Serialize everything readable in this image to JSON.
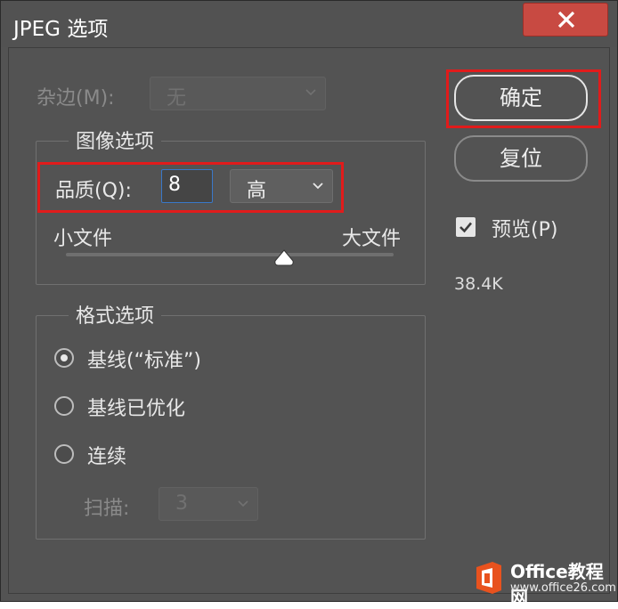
{
  "window": {
    "title": "JPEG 选项",
    "close_glyph": "✕"
  },
  "matte": {
    "label": "杂边(M):",
    "value": "无",
    "enabled": false
  },
  "image_options": {
    "title": "图像选项",
    "quality_label": "品质(Q):",
    "quality_value": "8",
    "quality_preset": "高",
    "slider_min_label": "小文件",
    "slider_max_label": "大文件",
    "slider_value": 8,
    "slider_max": 12
  },
  "format_options": {
    "title": "格式选项",
    "options": [
      {
        "label": "基线(“标准”)",
        "selected": true
      },
      {
        "label": "基线已优化",
        "selected": false
      },
      {
        "label": "连续",
        "selected": false
      }
    ],
    "scans_label": "扫描:",
    "scans_value": "3",
    "scans_enabled": false
  },
  "buttons": {
    "ok": "确定",
    "reset": "复位"
  },
  "preview": {
    "label": "预览(P)",
    "checked": true
  },
  "file_size": "38.4K",
  "watermark": {
    "brand": "Office教程网",
    "url": "www.office26.com"
  },
  "colors": {
    "dialog_bg": "#535353",
    "highlight_red": "#e11b1b",
    "close_red": "#c84a42",
    "watermark_orange": "#e8521e"
  }
}
